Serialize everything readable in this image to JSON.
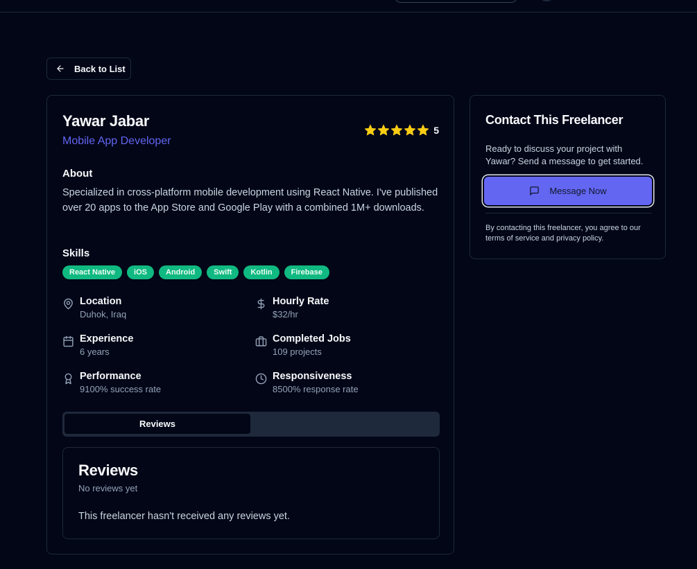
{
  "nav": {
    "back_label": "Back to List"
  },
  "profile": {
    "name": "Yawar Jabar",
    "role": "Mobile App Developer",
    "rating": "5",
    "about_heading": "About",
    "about_text": "Specialized in cross-platform mobile development using React Native. I've published over 20 apps to the App Store and Google Play with a combined 1M+ downloads.",
    "skills_heading": "Skills",
    "skills": [
      "React Native",
      "iOS",
      "Android",
      "Swift",
      "Kotlin",
      "Firebase"
    ],
    "stats": {
      "location": {
        "label": "Location",
        "value": "Duhok, Iraq"
      },
      "hourly_rate": {
        "label": "Hourly Rate",
        "value": "$32/hr"
      },
      "experience": {
        "label": "Experience",
        "value": "6 years"
      },
      "completed_jobs": {
        "label": "Completed Jobs",
        "value": "109 projects"
      },
      "performance": {
        "label": "Performance",
        "value": "9100% success rate"
      },
      "responsiveness": {
        "label": "Responsiveness",
        "value": "8500% response rate"
      }
    }
  },
  "tabs": [
    {
      "label": "Reviews",
      "active": true
    }
  ],
  "reviews": {
    "title": "Reviews",
    "subtitle": "No reviews yet",
    "empty_text": "This freelancer hasn't received any reviews yet."
  },
  "contact": {
    "title": "Contact This Freelancer",
    "description": "Ready to discuss your project with Yawar? Send a message to get started.",
    "button_label": "Message Now",
    "fine_print": "By contacting this freelancer, you agree to our terms of service and privacy policy."
  },
  "icons": {
    "back": "arrow-left-icon",
    "star": "star-icon",
    "location": "map-pin-icon",
    "rate": "dollar-icon",
    "experience": "calendar-icon",
    "jobs": "briefcase-icon",
    "performance": "award-icon",
    "responsiveness": "clock-icon",
    "message": "message-square-icon"
  },
  "colors": {
    "background": "#020617",
    "accent": "#6366f1",
    "skill_badge": "#10b981",
    "star": "#facc15",
    "border": "#1e293b"
  }
}
